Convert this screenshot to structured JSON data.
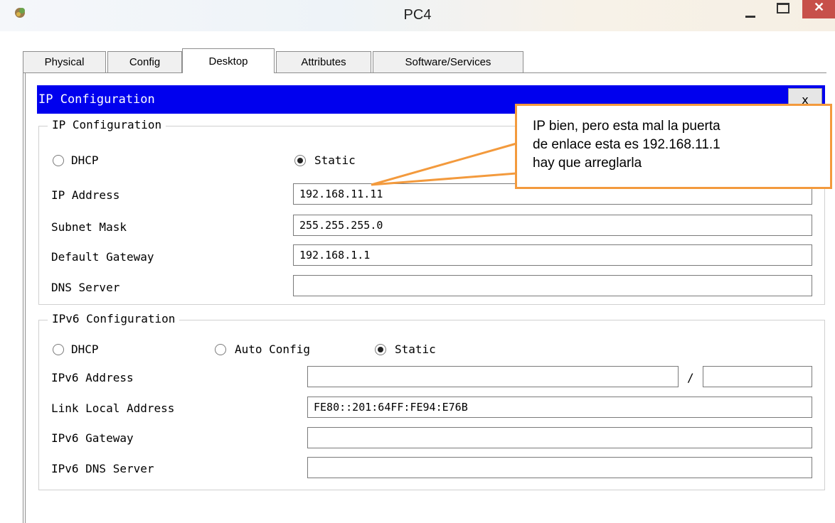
{
  "window": {
    "title": "PC4"
  },
  "tabs": [
    {
      "label": "Physical",
      "active": false
    },
    {
      "label": "Config",
      "active": false
    },
    {
      "label": "Desktop",
      "active": true
    },
    {
      "label": "Attributes",
      "active": false
    },
    {
      "label": "Software/Services",
      "active": false
    }
  ],
  "panel": {
    "title": "IP Configuration",
    "close_label": "x"
  },
  "ipv4": {
    "group_label": "IP Configuration",
    "mode": "Static",
    "dhcp_label": "DHCP",
    "static_label": "Static",
    "ip_label": "IP Address",
    "ip_value": "192.168.11.11",
    "mask_label": "Subnet Mask",
    "mask_value": "255.255.255.0",
    "gateway_label": "Default Gateway",
    "gateway_value": "192.168.1.1",
    "dns_label": "DNS Server",
    "dns_value": ""
  },
  "ipv6": {
    "group_label": "IPv6 Configuration",
    "mode": "Static",
    "dhcp_label": "DHCP",
    "auto_label": "Auto Config",
    "static_label": "Static",
    "address_label": "IPv6 Address",
    "address_value": "",
    "prefix_separator": "/",
    "prefix_value": "",
    "link_local_label": "Link Local Address",
    "link_local_value": "FE80::201:64FF:FE94:E76B",
    "gateway_label": "IPv6 Gateway",
    "gateway_value": "",
    "dns_label": "IPv6 DNS Server",
    "dns_value": ""
  },
  "annotation": {
    "lines": [
      "IP bien, pero esta mal la puerta",
      "de enlace esta es 192.168.11.1",
      "hay que arreglarla"
    ],
    "border_color": "#f39a3d"
  },
  "colors": {
    "panel_header": "#0000ee",
    "close_button": "#c7504a"
  },
  "icons": [
    "app-icon",
    "minimize-icon",
    "maximize-icon",
    "close-icon"
  ]
}
